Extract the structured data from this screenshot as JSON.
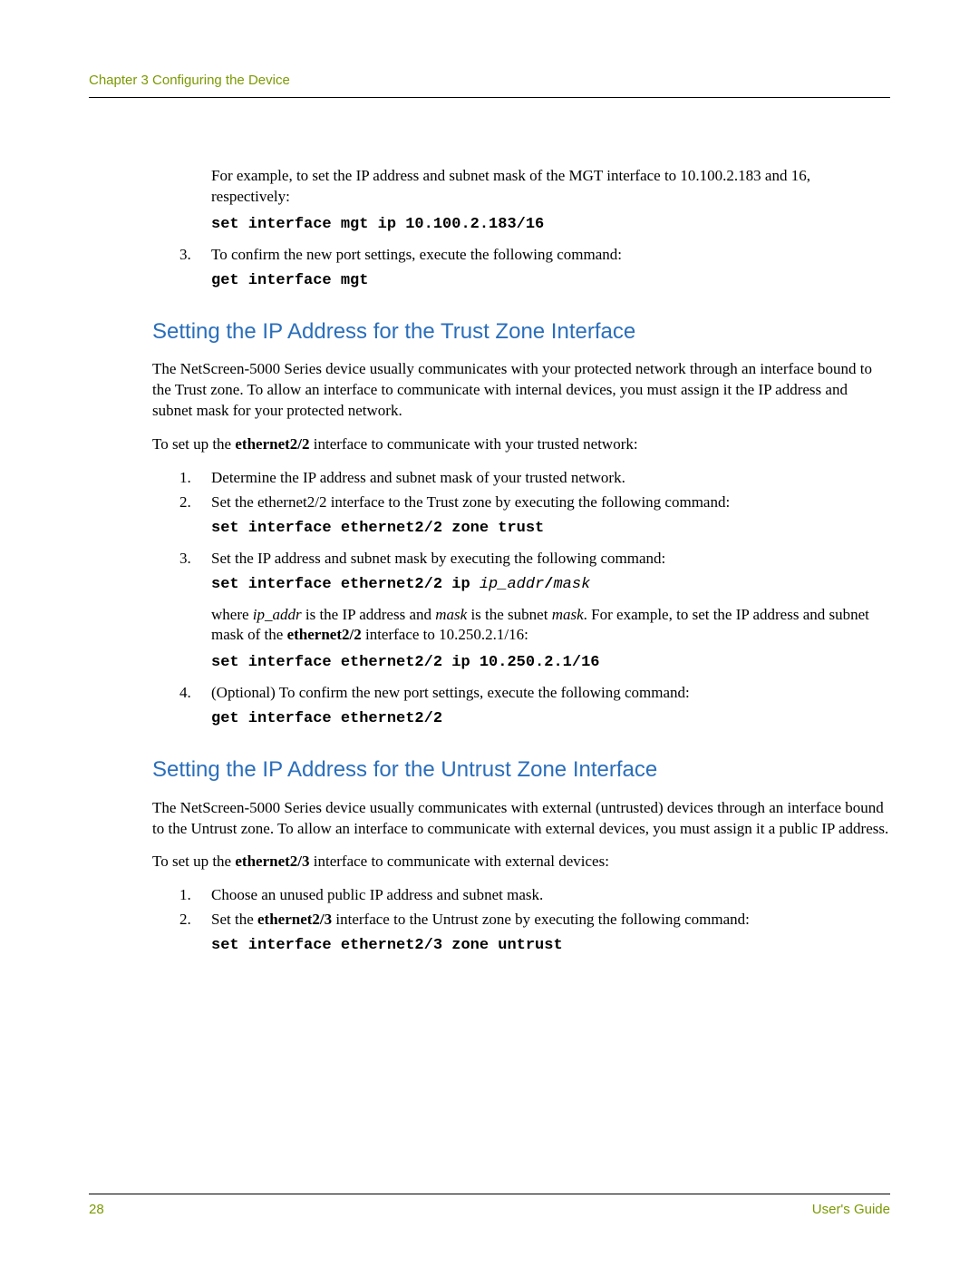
{
  "header": "Chapter 3 Configuring the Device",
  "intro": {
    "p1": "For example, to set the IP address and subnet mask of the MGT interface to 10.100.2.183 and 16, respectively:",
    "cmd1": "set interface mgt ip 10.100.2.183/16",
    "step3_num": "3.",
    "step3_text": "To confirm the new port settings, execute the following command:",
    "cmd2": "get interface mgt"
  },
  "trust": {
    "heading": "Setting the IP Address for the Trust Zone Interface",
    "p1": "The NetScreen-5000 Series device usually communicates with your protected network through an interface bound to the Trust zone. To allow an interface to communicate with internal devices, you must assign it the IP address and subnet mask for your protected network.",
    "p2_pre": "To set up the ",
    "p2_b": "ethernet2/2",
    "p2_post": " interface to communicate with your trusted network:",
    "s1_num": "1.",
    "s1_text": "Determine the IP address and subnet mask of your trusted network.",
    "s2_num": "2.",
    "s2_text": "Set the ethernet2/2 interface to the Trust zone by executing the following command:",
    "s2_cmd": "set interface ethernet2/2 zone trust",
    "s3_num": "3.",
    "s3_text": "Set the IP address and subnet mask by executing the following command:",
    "s3_cmd_a": "set interface ethernet2/2 ip ",
    "s3_cmd_b": "ip_addr",
    "s3_cmd_c": "/",
    "s3_cmd_d": "mask",
    "s3_where_1": "where ",
    "s3_where_2": "ip_addr",
    "s3_where_3": " is the IP address and ",
    "s3_where_4": "mask",
    "s3_where_5": " is the subnet ",
    "s3_where_6": "mask",
    "s3_where_7": ". For example, to set the IP address and subnet mask of the ",
    "s3_where_8": "ethernet2/2",
    "s3_where_9": " interface to 10.250.2.1/16:",
    "s3_cmd2": "set interface ethernet2/2 ip 10.250.2.1/16",
    "s4_num": "4.",
    "s4_text": "(Optional) To confirm the new port settings, execute the following command:",
    "s4_cmd": "get interface ethernet2/2"
  },
  "untrust": {
    "heading": "Setting the IP Address for the Untrust Zone Interface",
    "p1": "The NetScreen-5000 Series device usually communicates with external (untrusted) devices through an interface bound to the Untrust zone. To allow an interface to communicate with external devices, you must assign it a public IP address.",
    "p2_pre": "To set up the ",
    "p2_b": "ethernet2/3",
    "p2_post": " interface to communicate with external devices:",
    "s1_num": "1.",
    "s1_text": "Choose an unused public IP address and subnet mask.",
    "s2_num": "2.",
    "s2_text_1": "Set the ",
    "s2_text_2": "ethernet2/3",
    "s2_text_3": " interface to the Untrust zone by executing the following command:",
    "s2_cmd": "set interface ethernet2/3 zone untrust"
  },
  "footer": {
    "page": "28",
    "title": "User's Guide"
  }
}
